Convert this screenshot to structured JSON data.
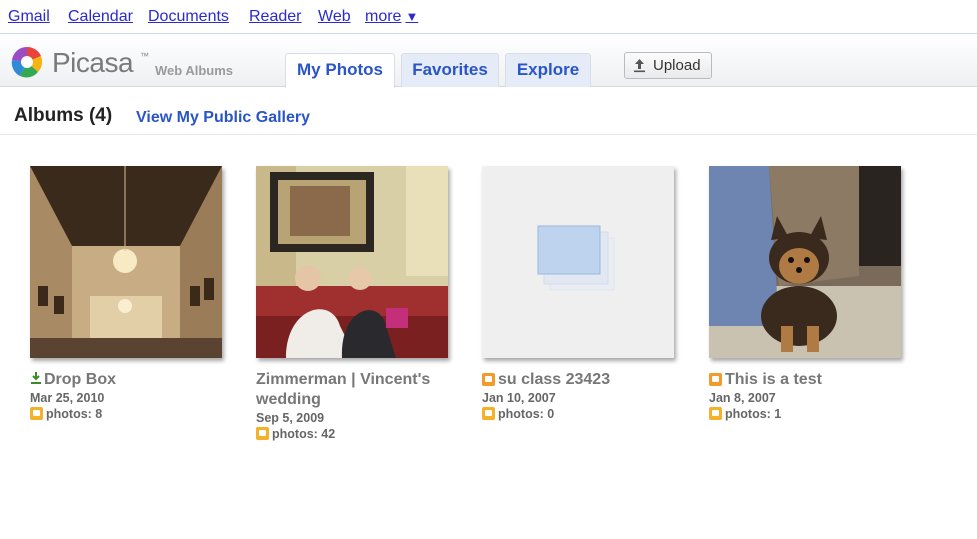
{
  "gbar": {
    "links": [
      "Gmail",
      "Calendar",
      "Documents",
      "Reader",
      "Web",
      "more"
    ],
    "more_arrow": "▼"
  },
  "header": {
    "logo_text": "Picasa",
    "logo_tm": "™",
    "logo_sub": "Web Albums",
    "tabs": [
      {
        "label": "My Photos",
        "active": true
      },
      {
        "label": "Favorites",
        "active": false
      },
      {
        "label": "Explore",
        "active": false
      }
    ],
    "upload_label": "Upload"
  },
  "albums": {
    "title": "Albums (4)",
    "gallery_link": "View My Public Gallery",
    "items": [
      {
        "title": "Drop Box",
        "date": "Mar 25, 2010",
        "count": "photos: 8",
        "icon": "download-icon"
      },
      {
        "title": "Zimmerman | Vincent's wedding",
        "date": "Sep 5, 2009",
        "count": "photos: 42",
        "icon": ""
      },
      {
        "title": "su class 23423",
        "date": "Jan 10, 2007",
        "count": "photos: 0",
        "icon": "blogger-icon"
      },
      {
        "title": "This is a test",
        "date": "Jan 8, 2007",
        "count": "photos: 1",
        "icon": "blogger-icon"
      }
    ]
  },
  "colors": {
    "link_blue": "#2a55c8",
    "tab_bg": "#e5ecf8",
    "blogger_orange": "#f39a2c"
  }
}
